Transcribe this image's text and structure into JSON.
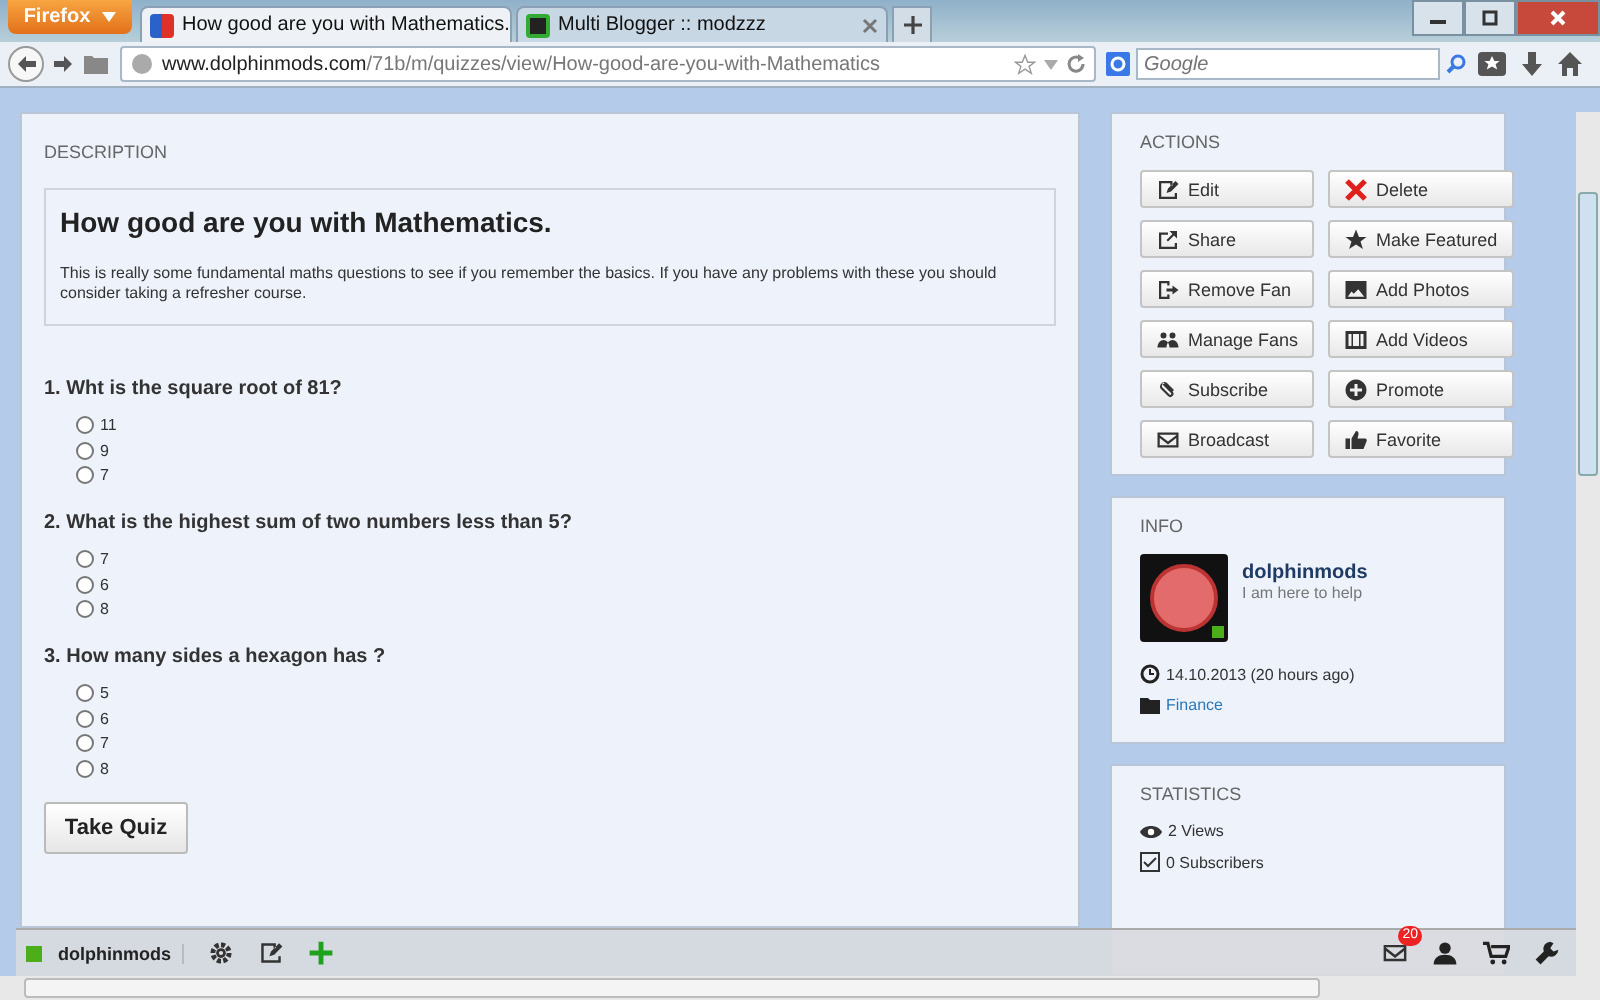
{
  "browser": {
    "menu_button": "Firefox",
    "tabs": [
      {
        "title": "How good are you with Mathematics.",
        "selected": true
      },
      {
        "title": "Multi Blogger :: modzzz",
        "selected": false
      }
    ],
    "url_domain": "www.dolphinmods.com",
    "url_path": "/71b/m/quizzes/view/How-good-are-you-with-Mathematics",
    "search": {
      "placeholder": "Google"
    }
  },
  "description": {
    "heading": "DESCRIPTION",
    "title": "How good are you with Mathematics.",
    "text": "This is really some fundamental maths questions to see if you remember the basics. If you have any problems with these you should consider taking a refresher course."
  },
  "questions": [
    {
      "text": "1. Wht is the square root of 81?",
      "options": [
        {
          "label": "11",
          "selected": false
        },
        {
          "label": "9",
          "selected": false
        },
        {
          "label": "7",
          "selected": false
        }
      ]
    },
    {
      "text": "2. What is the highest sum of two numbers less than 5?",
      "options": [
        {
          "label": "7",
          "selected": false
        },
        {
          "label": "6",
          "selected": false
        },
        {
          "label": "8",
          "selected": false
        }
      ]
    },
    {
      "text": "3. How many sides a hexagon has ?",
      "options": [
        {
          "label": "5",
          "selected": false
        },
        {
          "label": "6",
          "selected": false
        },
        {
          "label": "7",
          "selected": false
        },
        {
          "label": "8",
          "selected": false
        }
      ]
    }
  ],
  "take_quiz_button": "Take Quiz",
  "actions": {
    "heading": "ACTIONS",
    "buttons": [
      {
        "label": "Edit",
        "kind": "edit"
      },
      {
        "label": "Delete",
        "kind": "delete"
      },
      {
        "label": "Share",
        "kind": "share"
      },
      {
        "label": "Make Featured",
        "kind": "star"
      },
      {
        "label": "Remove Fan",
        "kind": "exit"
      },
      {
        "label": "Add Photos",
        "kind": "photo"
      },
      {
        "label": "Manage Fans",
        "kind": "users"
      },
      {
        "label": "Add Videos",
        "kind": "film"
      },
      {
        "label": "Subscribe",
        "kind": "clip"
      },
      {
        "label": "Promote",
        "kind": "plus"
      },
      {
        "label": "Broadcast",
        "kind": "mail"
      },
      {
        "label": "Favorite",
        "kind": "thumb"
      }
    ]
  },
  "info": {
    "heading": "INFO",
    "username": "dolphinmods",
    "tagline": "I am here to help",
    "date": "14.10.2013 (20 hours ago)",
    "category": "Finance"
  },
  "statistics": {
    "heading": "STATISTICS",
    "items": [
      {
        "text": "2 Views"
      },
      {
        "text": "0 Subscribers"
      }
    ]
  },
  "toolbar": {
    "username": "dolphinmods",
    "notification_count": "20"
  }
}
